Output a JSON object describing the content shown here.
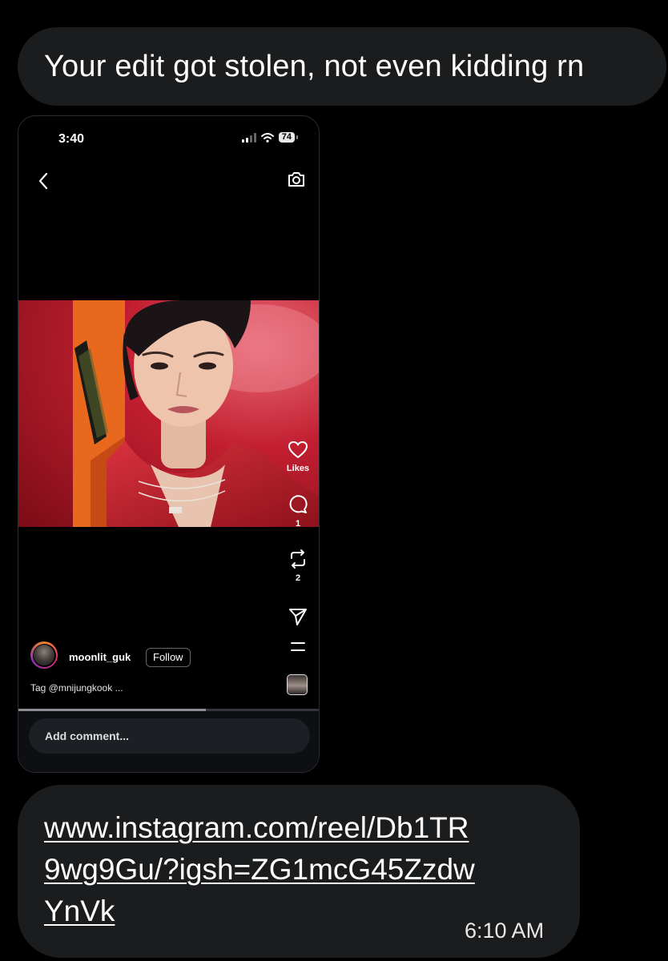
{
  "messages": {
    "top_text": "Your edit got stolen, not even kidding rn",
    "link_text": "www.instagram.com/reel/Db1TR9wg9Gu/?igsh=ZG1mcG45ZzdwYnVk",
    "timestamp": "6:10 AM"
  },
  "screenshot": {
    "status_time": "3:40",
    "battery": "74",
    "likes_label": "Likes",
    "comments_count": "1",
    "reposts_count": "2",
    "username": "moonlit_guk",
    "follow_label": "Follow",
    "caption": "Tag @mnijungkook ...",
    "comment_placeholder": "Add comment...",
    "video_progress": 0.62
  },
  "icons": {
    "back": "chevron-left-icon",
    "camera": "camera-icon",
    "like": "heart-icon",
    "comment": "comment-icon",
    "repost": "repost-icon",
    "share": "send-icon",
    "more": "menu-icon"
  },
  "colors": {
    "bubble_bg": "#1b1c1e",
    "page_bg": "#000000",
    "photo_red": "#c21f31"
  }
}
